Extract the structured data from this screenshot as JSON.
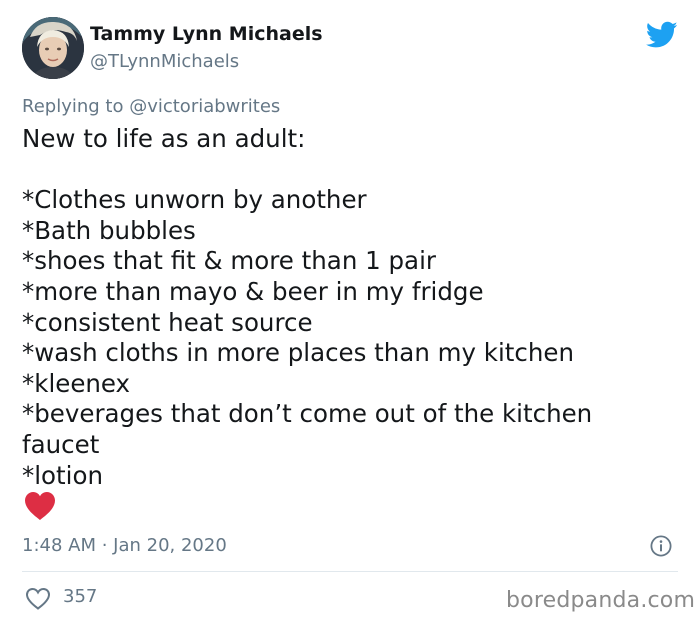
{
  "author": {
    "display_name": "Tammy Lynn Michaels",
    "handle": "@TLynnMichaels",
    "avatar_icon": "profile-photo"
  },
  "platform_icon": "twitter-bird-icon",
  "reply_context": {
    "prefix": "Replying to ",
    "handle": "@victoriabwrites"
  },
  "tweet": {
    "lines": [
      "New to life as an adult:",
      "",
      "*Clothes unworn by another",
      "*Bath bubbles",
      "*shoes that fit & more than 1 pair",
      "*more than mayo & beer in my fridge",
      "*consistent heat source",
      "*wash cloths in more places than my kitchen",
      "*kleenex",
      "*beverages that don’t come out of the kitchen",
      "faucet",
      "*lotion"
    ],
    "emoji": "red-heart"
  },
  "meta": {
    "timestamp": "1:48 AM · Jan 20, 2020",
    "info_icon": "info-icon"
  },
  "actions": {
    "like_count": "357",
    "like_icon": "heart-outline-icon"
  },
  "watermark": "boredpanda.com",
  "colors": {
    "text_primary": "#14171a",
    "text_secondary": "#657786",
    "twitter_blue": "#1da1f2",
    "heart_red": "#e0245e",
    "divider": "#e1e8ed"
  }
}
